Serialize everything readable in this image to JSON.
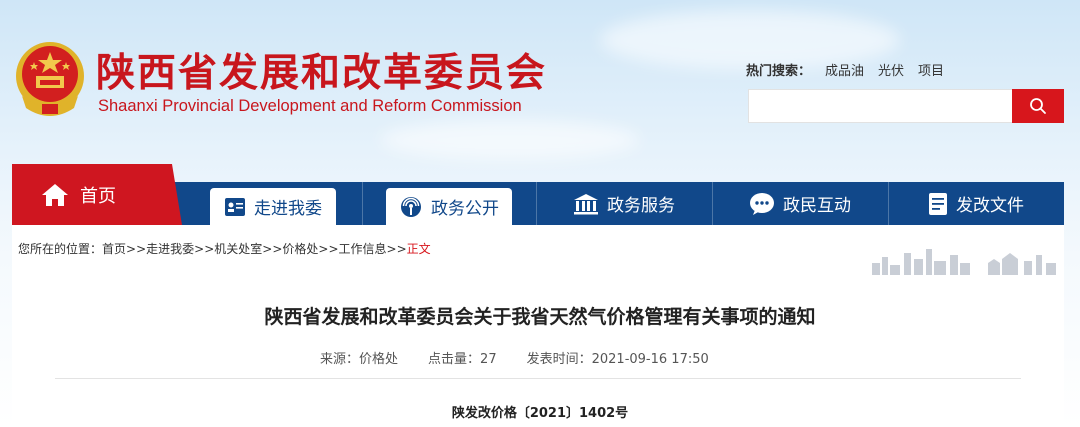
{
  "header": {
    "title_cn": "陕西省发展和改革委员会",
    "title_en": "Shaanxi Provincial Development and Reform Commission",
    "hot_search_label": "热门搜索：",
    "hot_keywords": [
      "成品油",
      "光伏",
      "项目"
    ],
    "search_placeholder": ""
  },
  "nav": {
    "home": "首页",
    "items": [
      {
        "label": "走进我委",
        "icon": "person-card-icon"
      },
      {
        "label": "政务公开",
        "icon": "broadcast-icon"
      },
      {
        "label": "政务服务",
        "icon": "government-building-icon"
      },
      {
        "label": "政民互动",
        "icon": "chat-bubble-icon"
      },
      {
        "label": "发改文件",
        "icon": "document-icon"
      }
    ]
  },
  "breadcrumb": {
    "prefix": "您所在的位置：",
    "items": [
      "首页",
      "走进我委",
      "机关处室",
      "价格处",
      "工作信息"
    ],
    "separator": ">>",
    "current": "正文"
  },
  "article": {
    "title": "陕西省发展和改革委员会关于我省天然气价格管理有关事项的通知",
    "source_label": "来源：",
    "source": "价格处",
    "clicks_label": "点击量：",
    "clicks": "27",
    "date_label": "发表时间：",
    "date": "2021-09-16 17:50",
    "doc_number": "陕发改价格〔2021〕1402号"
  },
  "colors": {
    "brand_red": "#c8161d",
    "nav_blue": "#11488a",
    "search_red": "#d7161c"
  }
}
